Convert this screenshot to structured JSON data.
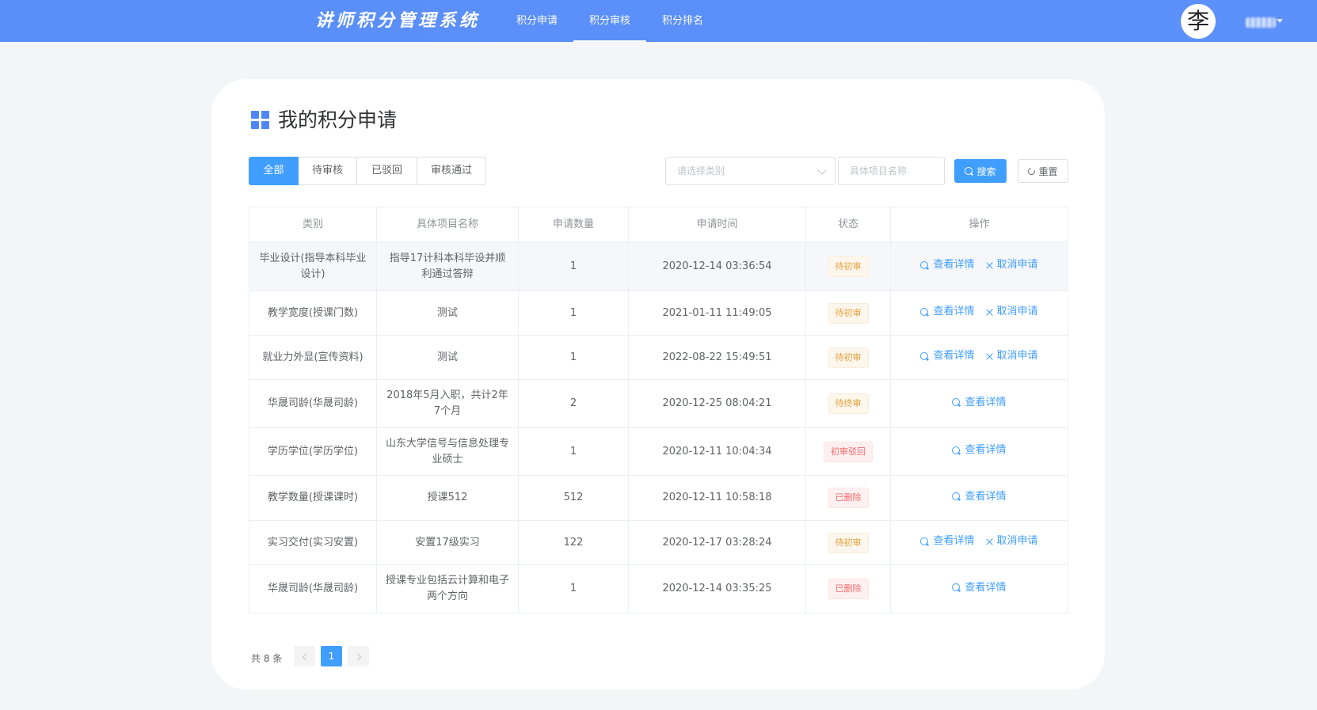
{
  "header": {
    "brand": "讲师积分管理系统",
    "nav": [
      {
        "label": "积分申请",
        "active": false
      },
      {
        "label": "积分审核",
        "active": true
      },
      {
        "label": "积分排名",
        "active": false
      }
    ],
    "avatar_text": "李",
    "accent_color": "#5b8ff9"
  },
  "page": {
    "title": "我的积分申请"
  },
  "filters": {
    "tabs": [
      "全部",
      "待审核",
      "已驳回",
      "审核通过"
    ],
    "active_tab": "全部",
    "category_placeholder": "请选择类别",
    "name_placeholder": "具体项目名称",
    "search_label": "搜索",
    "reset_label": "重置"
  },
  "table": {
    "columns": [
      "类别",
      "具体项目名称",
      "申请数量",
      "申请时间",
      "状态",
      "操作"
    ],
    "rows": [
      {
        "category": "毕业设计(指导本科毕业设计)",
        "name": "指导17计科本科毕设并顺利通过答辩",
        "quantity": "1",
        "time": "2020-12-14 03:36:54",
        "status": "待初审",
        "status_type": "warning",
        "actions": [
          "查看详情",
          "取消申请"
        ]
      },
      {
        "category": "教学宽度(授课门数)",
        "name": "测试",
        "quantity": "1",
        "time": "2021-01-11 11:49:05",
        "status": "待初审",
        "status_type": "warning",
        "actions": [
          "查看详情",
          "取消申请"
        ]
      },
      {
        "category": "就业力外显(宣传资料)",
        "name": "测试",
        "quantity": "1",
        "time": "2022-08-22 15:49:51",
        "status": "待初审",
        "status_type": "warning",
        "actions": [
          "查看详情",
          "取消申请"
        ]
      },
      {
        "category": "华晟司龄(华晟司龄)",
        "name": "2018年5月入职，共计2年7个月",
        "quantity": "2",
        "time": "2020-12-25 08:04:21",
        "status": "待终审",
        "status_type": "warning",
        "actions": [
          "查看详情"
        ]
      },
      {
        "category": "学历学位(学历学位)",
        "name": "山东大学信号与信息处理专业硕士",
        "quantity": "1",
        "time": "2020-12-11 10:04:34",
        "status": "初审驳回",
        "status_type": "danger",
        "actions": [
          "查看详情"
        ]
      },
      {
        "category": "教学数量(授课课时)",
        "name": "授课512",
        "quantity": "512",
        "time": "2020-12-11 10:58:18",
        "status": "已删除",
        "status_type": "danger",
        "actions": [
          "查看详情"
        ]
      },
      {
        "category": "实习交付(实习安置)",
        "name": "安置17级实习",
        "quantity": "122",
        "time": "2020-12-17 03:28:24",
        "status": "待初审",
        "status_type": "warning",
        "actions": [
          "查看详情",
          "取消申请"
        ]
      },
      {
        "category": "华晟司龄(华晟司龄)",
        "name": "授课专业包括云计算和电子两个方向",
        "quantity": "1",
        "time": "2020-12-14 03:35:25",
        "status": "已删除",
        "status_type": "danger",
        "actions": [
          "查看详情"
        ]
      }
    ]
  },
  "pagination": {
    "total_text": "共 8 条",
    "current_page": "1"
  }
}
